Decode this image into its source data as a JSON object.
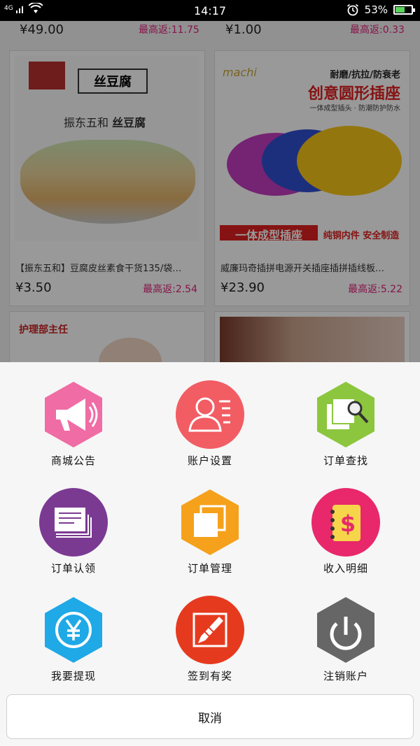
{
  "status_bar": {
    "network": "4G",
    "time": "14:17",
    "battery_percent": "53%",
    "battery_level": 0.53
  },
  "feed": {
    "top_row": [
      {
        "price": "¥49.00",
        "rebate": "最高返:11.75"
      },
      {
        "price": "¥1.00",
        "rebate": "最高返:0.33"
      }
    ],
    "cards": [
      {
        "title": "【振东五和】豆腐皮丝素食干货135/袋…",
        "price": "¥3.50",
        "rebate": "最高返:2.54",
        "image_brand": "振东五和",
        "image_product": "丝豆腐"
      },
      {
        "title": "威廉玛奇插拼电源开关插座插拼插线板…",
        "price": "¥23.90",
        "rebate": "最高返:5.22",
        "image_brand": "machi",
        "image_tagline": "耐磨/抗拉/防衰老",
        "image_headline": "创意圆形插座",
        "image_sub1": "一体成型插头 · 防潮防护防水",
        "image_banner": "一体成型插座",
        "image_banner2": "纯铜内件 安全制造"
      },
      {
        "image_text": "护理部主任"
      },
      {}
    ]
  },
  "menu": {
    "items": [
      {
        "label": "商城公告",
        "icon": "megaphone-icon",
        "color": "#f06ca4",
        "shape": "hexagon"
      },
      {
        "label": "账户设置",
        "icon": "user-icon",
        "color": "#f25c63",
        "shape": "circle"
      },
      {
        "label": "订单查找",
        "icon": "search-doc-icon",
        "color": "#8cc63e",
        "shape": "hexagon"
      },
      {
        "label": "订单认领",
        "icon": "documents-icon",
        "color": "#7b3a92",
        "shape": "circle"
      },
      {
        "label": "订单管理",
        "icon": "copy-icon",
        "color": "#f5a11b",
        "shape": "hexagon"
      },
      {
        "label": "收入明细",
        "icon": "ledger-dollar-icon",
        "color": "#e8286b",
        "shape": "circle"
      },
      {
        "label": "我要提现",
        "icon": "yen-icon",
        "color": "#1fa9e6",
        "shape": "hexagon"
      },
      {
        "label": "签到有奖",
        "icon": "pen-sign-icon",
        "color": "#e63a1f",
        "shape": "circle"
      },
      {
        "label": "注销账户",
        "icon": "power-icon",
        "color": "#666666",
        "shape": "hexagon"
      }
    ],
    "cancel_label": "取消"
  }
}
